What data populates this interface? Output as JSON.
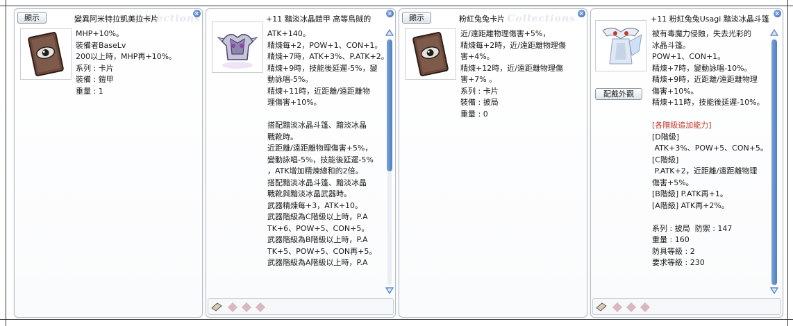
{
  "watermark": "Collections",
  "panel1": {
    "display_button": "顯示",
    "title": "變異阿米特拉凱美拉卡片",
    "lines": [
      "MHP+10%。",
      "裝備者BaseLv",
      "200以上時，MHP再+10%。"
    ],
    "type_label": "系列 : 卡片",
    "equip_label": "裝備 : 鎧甲",
    "weight_label": "重量 : 1",
    "image_icon": "eye-card-icon"
  },
  "panel2": {
    "title": "+11 黯淡冰晶鎧甲 高等鳥賊的",
    "lines": [
      "ATK+140。",
      "精煉每+2，POW+1、CON+1。",
      "精煉+7時，ATK+3%、P.ATK+2。",
      "精煉+9時，技能後延遲-5%，變",
      "動詠唱-5%。",
      "精煉+11時，近距離/遠距離物",
      "理傷害+10%。",
      "",
      "搭配黯淡冰晶斗篷、黯淡冰晶",
      "戰靴時。",
      "近距離/遠距離物理傷害+5%，",
      "變動詠唱-5%，技能後延遲-5%",
      "，ATK增加精煉總和的2倍。",
      "搭配黯淡冰晶斗篷、黯淡冰晶",
      "戰靴與黯淡冰晶武器時。",
      "武器精煉每+3，ATK+10。",
      "武器階級為C階級以上時，P.A",
      "TK+6、POW+5、CON+5。",
      "武器階級為B階級以上時，P.A",
      "TK+5、POW+5、CON再+5。",
      "武器階級為A階級以上時，P.A"
    ],
    "image_icon": "ice-armor-icon"
  },
  "panel3": {
    "display_button": "顯示",
    "title": "粉紅兔兔卡片",
    "lines": [
      "近/遠距離物理傷害+5%，",
      "精煉每+2時，近/遠距離物理傷",
      "害+4%。",
      "精煉+12時，近/遠距離物理傷",
      "害+7% 。"
    ],
    "type_label": "系列 : 卡片",
    "equip_label": "裝備 : 披局",
    "weight_label": "重量 : 0",
    "image_icon": "eye-card-icon"
  },
  "panel4": {
    "title": "+11 粉紅兔兔Usagi 黯淡冰晶斗篷",
    "wear_button": "配戴外觀",
    "lines": [
      "被有毒魔力侵蝕，失去光彩的",
      "冰晶斗篷。",
      "POW+1、CON+1。",
      "精煉+7時，變動詠唱-10%。",
      "精煉+9時，近距離/遠距離物理",
      "傷害+10%。",
      "精煉+11時，技能後延遲-10%。",
      ""
    ],
    "grade_header": "[各階級追加能力]",
    "grade_lines": [
      "[D階級]",
      " ATK+3%、POW+5、CON+5。",
      "[C階級]",
      " P.ATK+2，近距離/遠距離物理",
      "傷害+5%。",
      "[B階級] P.ATK再+1。",
      "[A階級] ATK再+2%。",
      ""
    ],
    "type_def_label": "系列 : 披局  防禦 : 147",
    "weight_label": "重量 : 160",
    "armor_level_label": "防具等級 : 2",
    "req_level_label": "要求等級 : 230",
    "image_icon": "ice-cloak-icon"
  },
  "colors": {
    "border": "#b5bfc9",
    "scroll": "#5a86c8",
    "grade_header": "#c0392b",
    "slot_gem": "#d9b9c0"
  }
}
